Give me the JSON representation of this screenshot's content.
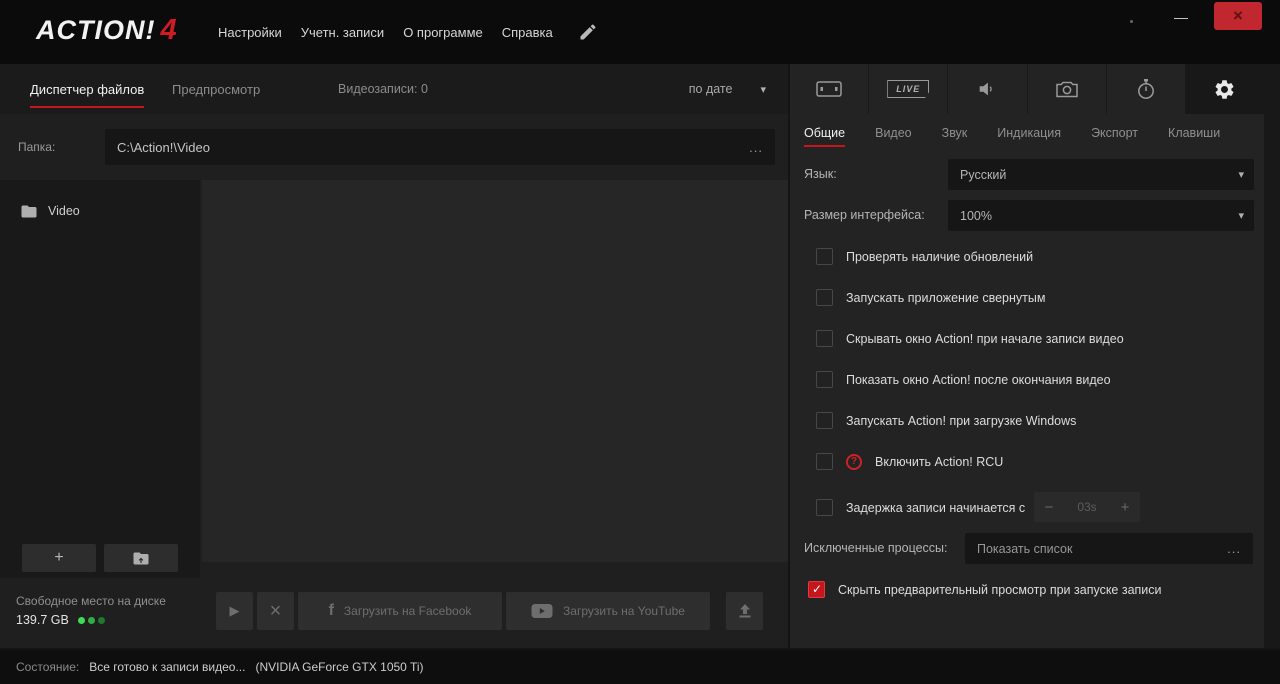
{
  "topbar": {
    "logo_text": "ACTION!",
    "logo_version": "4",
    "menu": [
      "Настройки",
      "Учетн. записи",
      "О программе",
      "Справка"
    ],
    "minimize_glyph": "—",
    "close_glyph": "×"
  },
  "file_manager": {
    "tab_file_manager": "Диспетчер файлов",
    "tab_preview": "Предпросмотр",
    "recordings_count": "Видеозаписи: 0",
    "sort_by": "по дате",
    "folder_label": "Папка:",
    "folder_path": "C:\\Action!\\Video",
    "browse_ellipsis": "...",
    "video_item": "Video",
    "add_button": "+",
    "free_space_label": "Свободное место на диске",
    "free_space_value": "139.7 GB",
    "play_glyph": "▶",
    "delete_glyph": "×",
    "facebook_initial": "f",
    "facebook_label": "Загрузить на Facebook",
    "youtube_label": "Загрузить на YouTube"
  },
  "settings": {
    "live_label": "LIVE",
    "tabs": [
      "Общие",
      "Видео",
      "Звук",
      "Индикация",
      "Экспорт",
      "Клавиши"
    ],
    "language_label": "Язык:",
    "language_value": "Русский",
    "ui_size_label": "Размер интерфейса:",
    "ui_size_value": "100%",
    "checkboxes": [
      {
        "label": "Проверять наличие обновлений",
        "checked": false
      },
      {
        "label": "Запускать приложение свернутым",
        "checked": false
      },
      {
        "label": "Скрывать окно Action! при начале записи видео",
        "checked": false
      },
      {
        "label": "Показать окно Action! после окончания видео",
        "checked": false
      },
      {
        "label": "Запускать Action! при загрузке Windows",
        "checked": false
      },
      {
        "label": "Включить Action! RCU",
        "checked": false,
        "help_glyph": "?"
      }
    ],
    "delay": {
      "label": "Задержка записи начинается с",
      "checked": false,
      "minus": "−",
      "value": "03s",
      "plus": "+"
    },
    "excluded_label": "Исключенные процессы:",
    "excluded_value": "Показать список",
    "excluded_ellipsis": "...",
    "hide_preview_label": "Скрыть предварительный просмотр при запуске записи",
    "hide_preview_checked": true
  },
  "status": {
    "label": "Состояние:",
    "message": "Все готово к записи видео...",
    "gpu": "(NVIDIA GeForce GTX 1050 Ti)"
  },
  "colors": {
    "accent_red": "#c4161c",
    "indicator_green": "#34b44a"
  },
  "chevron_glyph": "▾"
}
